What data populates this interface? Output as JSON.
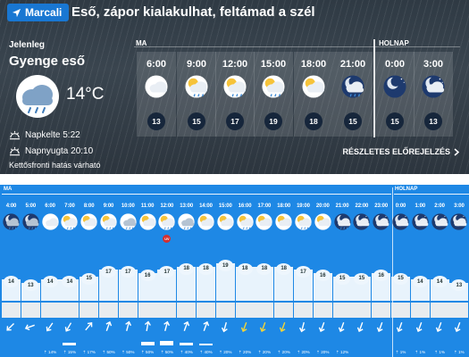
{
  "header": {
    "location_button": "Marcali",
    "headline": "Eső, zápor kialakulhat, feltámad a szél"
  },
  "current": {
    "label": "Jelenleg",
    "condition": "Gyenge eső",
    "temperature": "14°C",
    "icon": "cloud-rain-icon",
    "sunrise": "Napkelte 5:22",
    "sunset": "Napnyugta 20:10",
    "note": "Kettősfronti hatás várható"
  },
  "forecast_top": {
    "today_label": "MA",
    "tomorrow_label": "HOLNAP",
    "detail_link": "RÉSZLETES ELŐREJELZÉS",
    "hours": [
      {
        "time": "6:00",
        "temp": "13",
        "icon": "cloudy-icon"
      },
      {
        "time": "9:00",
        "temp": "15",
        "icon": "partly-cloudy-rain-icon"
      },
      {
        "time": "12:00",
        "temp": "17",
        "icon": "partly-cloudy-rain-icon"
      },
      {
        "time": "15:00",
        "temp": "19",
        "icon": "sun-cloud-rain-icon"
      },
      {
        "time": "18:00",
        "temp": "18",
        "icon": "sun-cloud-icon"
      },
      {
        "time": "21:00",
        "temp": "15",
        "icon": "night-cloud-rain-icon"
      },
      {
        "time": "0:00",
        "temp": "15",
        "icon": "night-clear-icon"
      },
      {
        "time": "3:00",
        "temp": "13",
        "icon": "night-cloud-icon"
      }
    ]
  },
  "hourly": {
    "today_label": "MA",
    "tomorrow_label": "HOLNAP",
    "uv_label": "UV",
    "hours": [
      {
        "time": "4:00",
        "temp": 14,
        "icon": "night-rain-icon",
        "precip": "",
        "pbar": 0,
        "wind_deg": 225
      },
      {
        "time": "5:00",
        "temp": 13,
        "icon": "night-rain-icon",
        "precip": "",
        "pbar": 0,
        "wind_deg": 250
      },
      {
        "time": "6:00",
        "temp": 14,
        "icon": "cloudy-icon",
        "precip": "14%",
        "pbar": 0,
        "wind_deg": 215
      },
      {
        "time": "7:00",
        "temp": 14,
        "icon": "partly-cloudy-rain-icon",
        "precip": "15%",
        "pbar": 3,
        "wind_deg": 210
      },
      {
        "time": "8:00",
        "temp": 15,
        "icon": "partly-cloudy-icon",
        "precip": "17%",
        "pbar": 0,
        "wind_deg": 40
      },
      {
        "time": "9:00",
        "temp": 17,
        "icon": "partly-cloudy-rain-icon",
        "precip": "50%",
        "pbar": 0,
        "wind_deg": 20
      },
      {
        "time": "10:00",
        "temp": 17,
        "icon": "cloud-rain-icon",
        "precip": "50%",
        "pbar": 0,
        "wind_deg": 15
      },
      {
        "time": "11:00",
        "temp": 16,
        "icon": "partly-cloudy-icon",
        "precip": "50%",
        "pbar": 4,
        "wind_deg": 10
      },
      {
        "time": "12:00",
        "temp": 17,
        "icon": "partly-cloudy-rain-icon",
        "precip": "50%",
        "pbar": 5,
        "wind_deg": 15,
        "uv": true
      },
      {
        "time": "13:00",
        "temp": 18,
        "icon": "cloud-rain-icon",
        "precip": "40%",
        "pbar": 3,
        "wind_deg": 20
      },
      {
        "time": "14:00",
        "temp": 18,
        "icon": "partly-cloudy-icon",
        "precip": "40%",
        "pbar": 2,
        "wind_deg": 20
      },
      {
        "time": "15:00",
        "temp": 19,
        "icon": "sun-cloud-icon",
        "precip": "20%",
        "pbar": 0,
        "wind_deg": 195
      },
      {
        "time": "16:00",
        "temp": 18,
        "icon": "sun-cloud-rain-icon",
        "precip": "20%",
        "pbar": 0,
        "wind_deg": 200,
        "gust": true
      },
      {
        "time": "17:00",
        "temp": 18,
        "icon": "sun-cloud-icon",
        "precip": "20%",
        "pbar": 0,
        "wind_deg": 200,
        "gust": true
      },
      {
        "time": "18:00",
        "temp": 18,
        "icon": "sun-cloud-icon",
        "precip": "20%",
        "pbar": 0,
        "wind_deg": 200,
        "gust": true
      },
      {
        "time": "19:00",
        "temp": 17,
        "icon": "sun-cloud-rain-icon",
        "precip": "20%",
        "pbar": 0,
        "wind_deg": 195
      },
      {
        "time": "20:00",
        "temp": 16,
        "icon": "sun-cloud-icon",
        "precip": "20%",
        "pbar": 0,
        "wind_deg": 200
      },
      {
        "time": "21:00",
        "temp": 15,
        "icon": "night-cloud-rain-icon",
        "precip": "12%",
        "pbar": 0,
        "wind_deg": 200
      },
      {
        "time": "22:00",
        "temp": 15,
        "icon": "night-cloud-icon",
        "precip": "",
        "pbar": 0,
        "wind_deg": 200
      },
      {
        "time": "23:00",
        "temp": 16,
        "icon": "night-cloud-icon",
        "precip": "",
        "pbar": 0,
        "wind_deg": 200
      },
      {
        "time": "0:00",
        "temp": 15,
        "icon": "night-cloud-icon",
        "precip": "1%",
        "pbar": 0,
        "wind_deg": 200
      },
      {
        "time": "1:00",
        "temp": 14,
        "icon": "night-cloud-icon",
        "precip": "1%",
        "pbar": 0,
        "wind_deg": 200
      },
      {
        "time": "2:00",
        "temp": 14,
        "icon": "night-cloud-icon",
        "precip": "1%",
        "pbar": 0,
        "wind_deg": 200
      },
      {
        "time": "3:00",
        "temp": 13,
        "icon": "night-cloud-icon",
        "precip": "1%",
        "pbar": 0,
        "wind_deg": 200
      }
    ]
  },
  "colors": {
    "location_button": "#1977d2",
    "hourly_background": "#1e88e5",
    "uv_badge": "#d32f2f",
    "top_background": "#333e48"
  }
}
